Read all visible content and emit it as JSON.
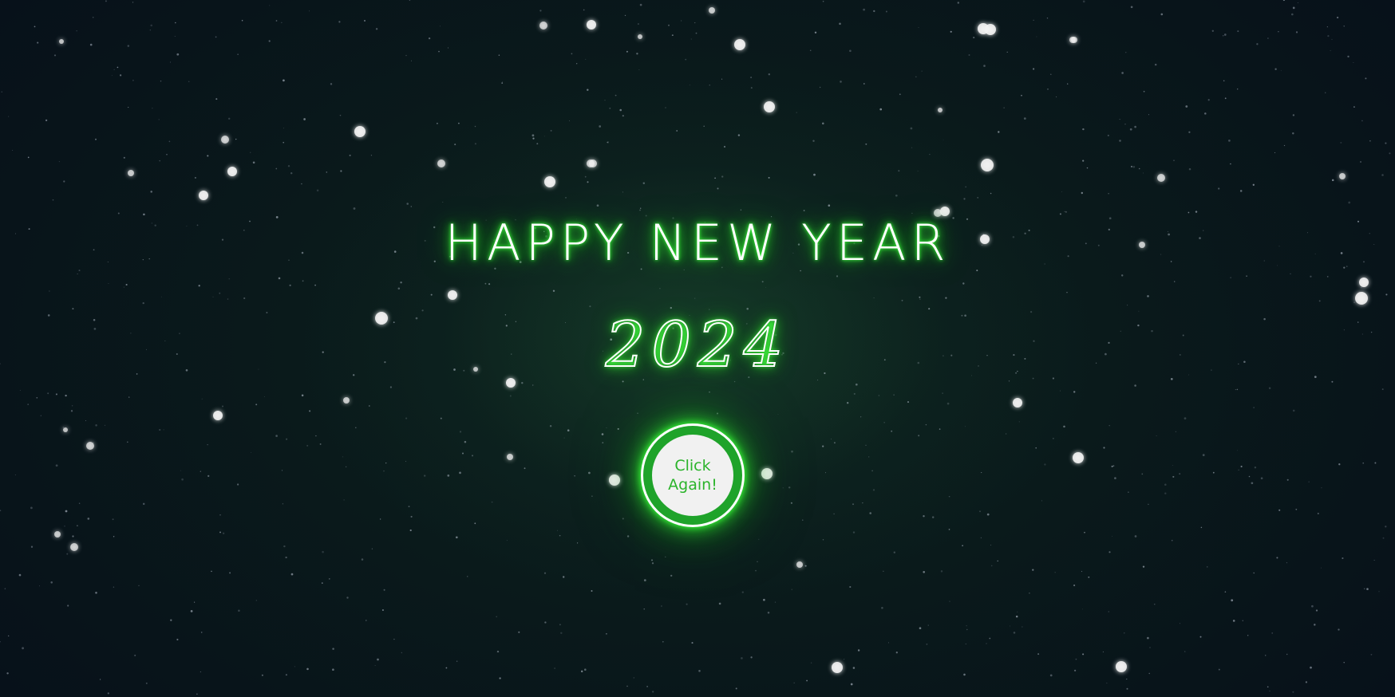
{
  "greeting": {
    "title": "HAPPY NEW YEAR",
    "year": "2024"
  },
  "action_button": {
    "label": "Click\nAgain!"
  },
  "colors": {
    "glow_green": "#2fe02f",
    "button_ring": "#1fa32a",
    "button_face": "#f1f1f1",
    "button_text": "#2bb42b",
    "background": "#0a1a1b"
  }
}
